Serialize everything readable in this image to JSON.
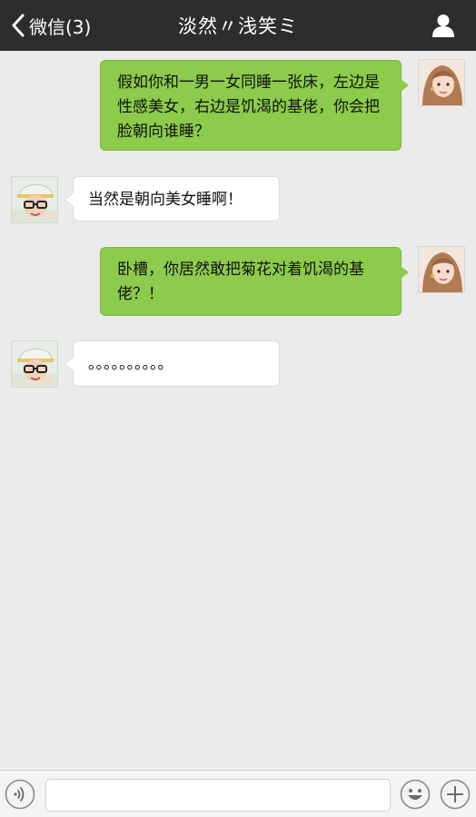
{
  "header": {
    "back_label": "微信(3)",
    "title": "淡然〃浅笑ミ"
  },
  "messages": [
    {
      "direction": "outgoing",
      "text": "假如你和一男一女同睡一张床，左边是性感美女，右边是饥渴的基佬，你会把脸朝向谁睡？"
    },
    {
      "direction": "incoming",
      "text": "当然是朝向美女睡啊！"
    },
    {
      "direction": "outgoing",
      "text": "卧槽，你居然敢把菊花对着饥渴的基佬？！"
    },
    {
      "direction": "incoming",
      "text": "。。。。。。。。。。"
    }
  ],
  "input": {
    "value": "",
    "placeholder": ""
  },
  "icons": {
    "back": "chevron-left-icon",
    "profile": "person-icon",
    "voice": "voice-icon",
    "emoji": "emoji-icon",
    "plus": "plus-icon"
  },
  "colors": {
    "topbar": "#2d2d2f",
    "outgoing_bubble": "#8ccb4b",
    "incoming_bubble": "#ffffff",
    "background": "#ebebeb"
  }
}
